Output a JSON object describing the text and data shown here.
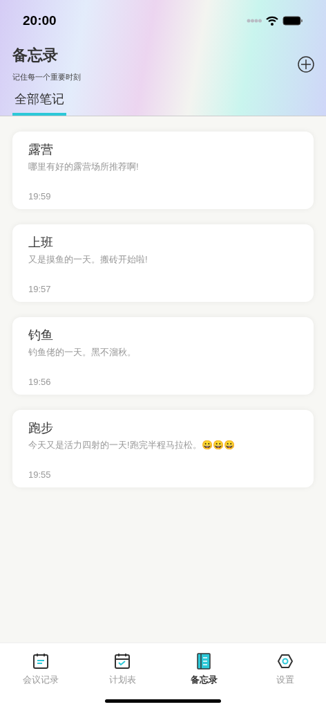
{
  "status_bar": {
    "time": "20:00"
  },
  "header": {
    "title": "备忘录",
    "subtitle": "记住每一个重要时刻"
  },
  "tabs": [
    {
      "label": "全部笔记",
      "selected": true
    }
  ],
  "notes": [
    {
      "title": "露营",
      "body": "哪里有好的露营场所推荐啊!",
      "time": "19:59"
    },
    {
      "title": "上班",
      "body": "又是摸鱼的一天。搬砖开始啦!",
      "time": "19:57"
    },
    {
      "title": "钓鱼",
      "body": "钓鱼佬的一天。黑不溜秋。",
      "time": "19:56"
    },
    {
      "title": "跑步",
      "body": "今天又是活力四射的一天!跑完半程马拉松。😀😀😀",
      "time": "19:55"
    }
  ],
  "tab_bar": [
    {
      "label": "会议记录",
      "kind": "meeting",
      "selected": false
    },
    {
      "label": "计划表",
      "kind": "plan",
      "selected": false
    },
    {
      "label": "备忘录",
      "kind": "memo",
      "selected": true
    },
    {
      "label": "设置",
      "kind": "settings",
      "selected": false
    }
  ]
}
